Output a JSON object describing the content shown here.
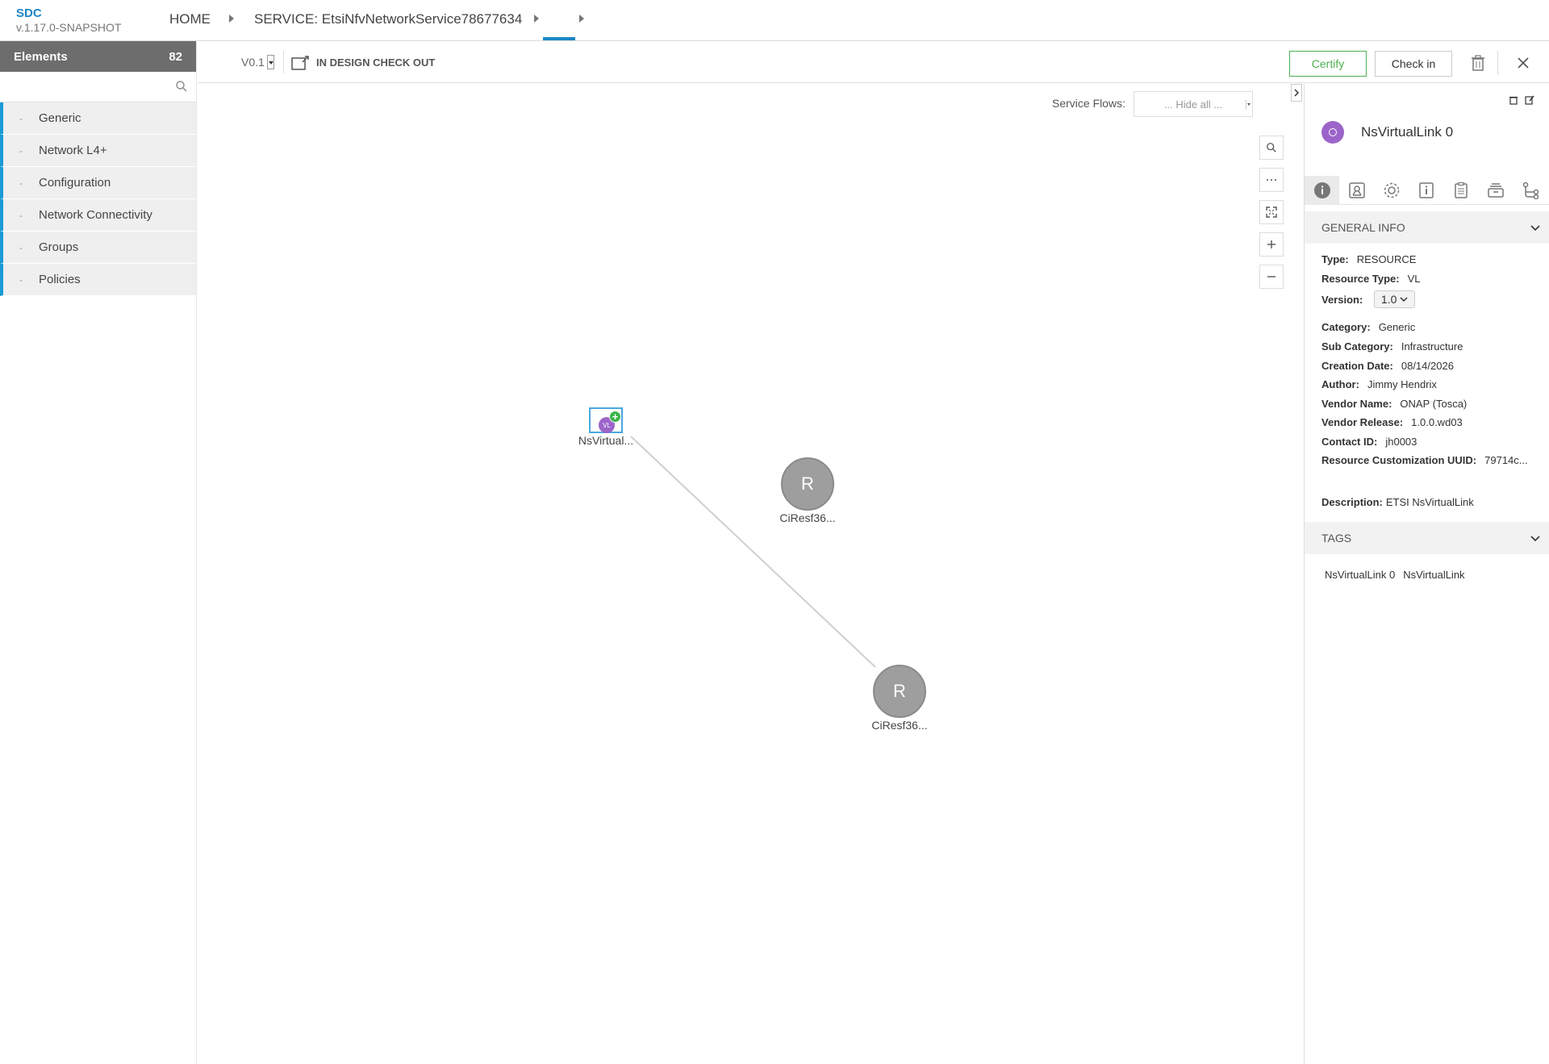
{
  "header": {
    "app_name": "SDC",
    "app_version": "v.1.17.0-SNAPSHOT",
    "breadcrumb_home": "HOME",
    "breadcrumb_service": "SERVICE: EtsiNfvNetworkService78677634"
  },
  "left_panel": {
    "title": "Elements",
    "count": "82",
    "search_placeholder": "",
    "categories": [
      {
        "label": "Generic"
      },
      {
        "label": "Network L4+"
      },
      {
        "label": "Configuration"
      },
      {
        "label": "Network Connectivity"
      },
      {
        "label": "Groups"
      },
      {
        "label": "Policies"
      }
    ]
  },
  "toolbar": {
    "version": "V0.1",
    "status": "IN DESIGN CHECK OUT",
    "certify_label": "Certify",
    "checkin_label": "Check in"
  },
  "canvas": {
    "service_flows_label": "Service Flows:",
    "service_flows_value": "... Hide all ...",
    "nodes": [
      {
        "label": "NsVirtual...",
        "icon_text": "VL"
      },
      {
        "label": "CiResf36...",
        "icon_text": "R"
      },
      {
        "label": "CiResf36...",
        "icon_text": "R"
      }
    ]
  },
  "right_panel": {
    "title": "NsVirtualLink 0",
    "general_info_title": "GENERAL INFO",
    "type_label": "Type:",
    "type_value": "RESOURCE",
    "resource_type_label": "Resource Type:",
    "resource_type_value": "VL",
    "version_label": "Version:",
    "version_value": "1.0",
    "category_label": "Category:",
    "category_value": "Generic",
    "sub_category_label": "Sub Category:",
    "sub_category_value": "Infrastructure",
    "creation_date_label": "Creation Date:",
    "creation_date_value": "08/14/2026",
    "author_label": "Author:",
    "author_value": "Jimmy Hendrix",
    "vendor_name_label": "Vendor Name:",
    "vendor_name_value": "ONAP (Tosca)",
    "vendor_release_label": "Vendor Release:",
    "vendor_release_value": "1.0.0.wd03",
    "contact_id_label": "Contact ID:",
    "contact_id_value": "jh0003",
    "uuid_label": "Resource Customization UUID:",
    "uuid_value": "79714c...",
    "description_label": "Description:",
    "description_value": "ETSI NsVirtualLink",
    "tags_title": "TAGS",
    "tags": [
      "NsVirtualLink 0",
      "NsVirtualLink"
    ]
  },
  "colors": {
    "accent": "#1b86c5",
    "category_bar": "#1b9ad6",
    "certify": "#4caf50",
    "vl_node": "#9c64c9",
    "resource_node": "#9e9e9e"
  }
}
